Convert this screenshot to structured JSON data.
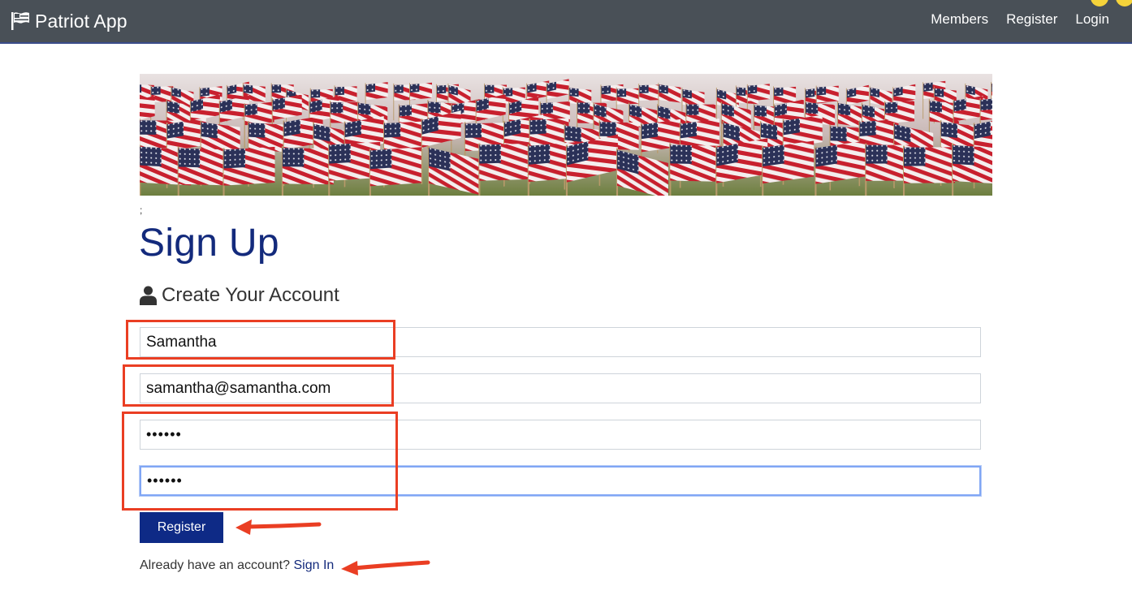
{
  "navbar": {
    "brand": "Patriot App",
    "links": [
      "Members",
      "Register",
      "Login"
    ],
    "brand_icon": "flag-icon",
    "bg_color": "#495057"
  },
  "banner": {
    "icon": "american-flags-banner-image"
  },
  "stray_text": ";",
  "page": {
    "title": "Sign Up",
    "subtitle": "Create Your Account",
    "subtitle_icon": "user-icon",
    "title_color": "#132a7c"
  },
  "form": {
    "name_value": "Samantha",
    "email_value": "samantha@samantha.com",
    "password_value": "••••••",
    "confirm_value": "••••••",
    "submit_label": "Register",
    "submit_color": "#0e2a86"
  },
  "footer": {
    "prompt": "Already have an account?",
    "signin_label": "Sign In"
  },
  "annotation_color": "#ea3e23"
}
